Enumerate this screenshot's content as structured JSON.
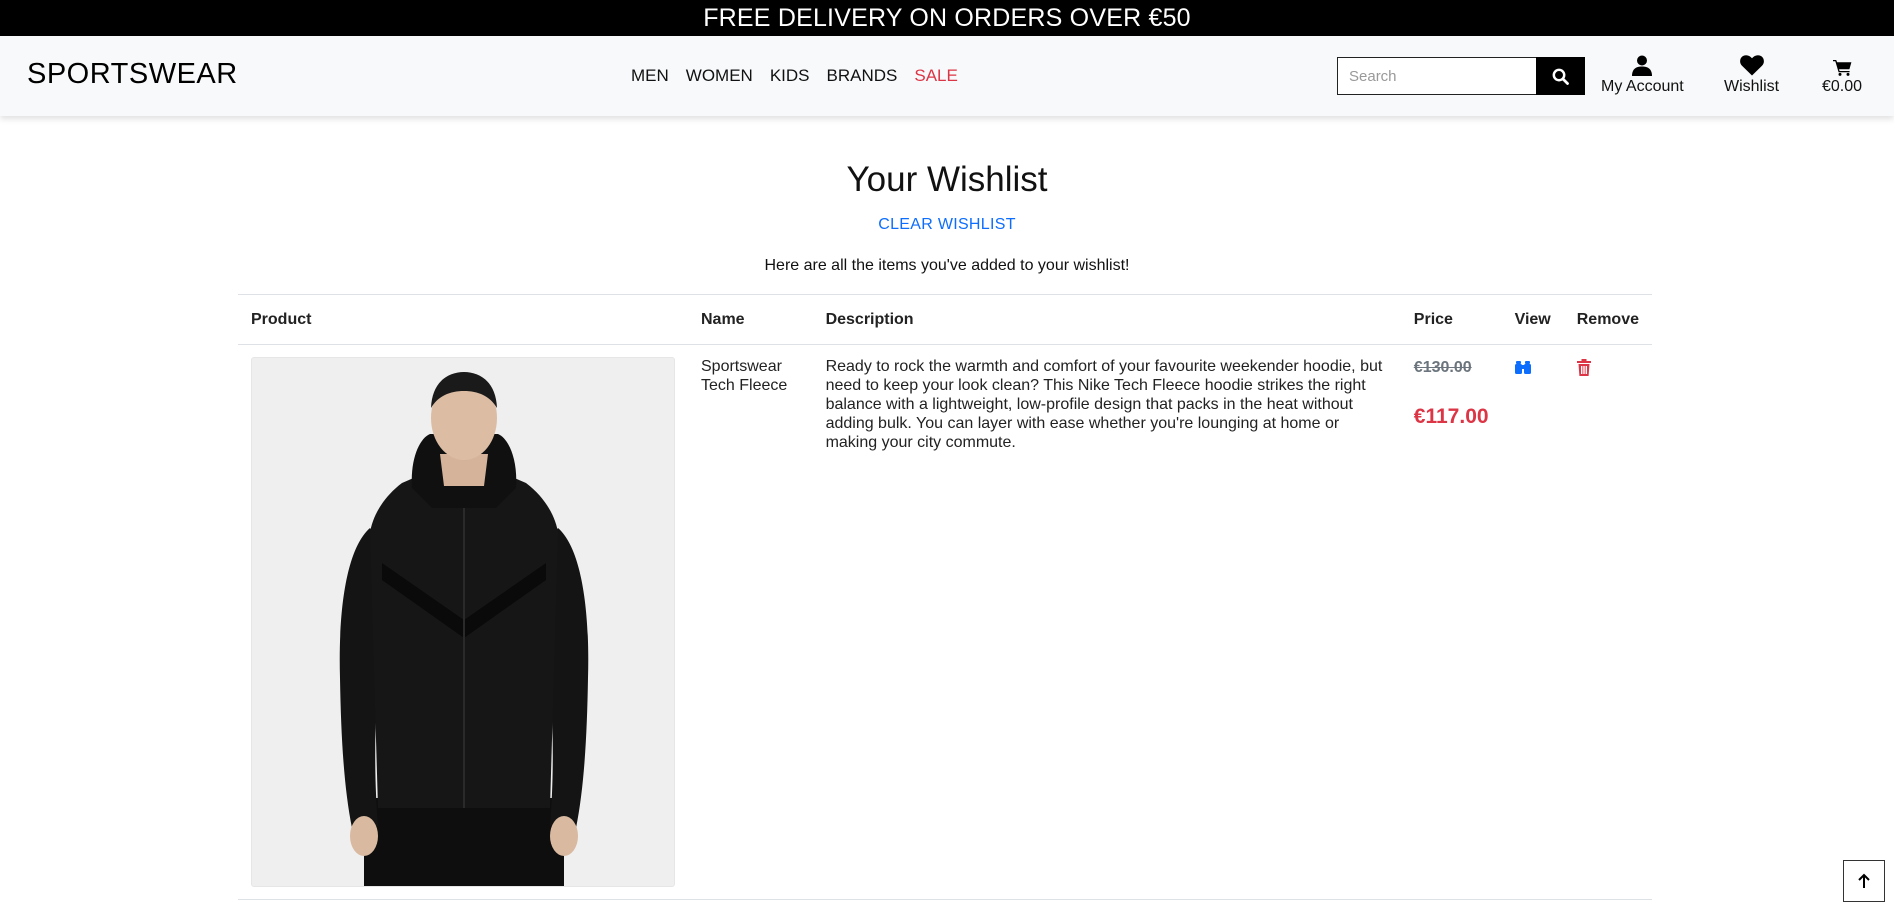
{
  "promo": {
    "text": "FREE DELIVERY ON ORDERS OVER €50"
  },
  "header": {
    "logo": "SPORTSWEAR",
    "nav": [
      {
        "label": "MEN"
      },
      {
        "label": "WOMEN"
      },
      {
        "label": "KIDS"
      },
      {
        "label": "BRANDS"
      },
      {
        "label": "SALE",
        "color": "#dc3545"
      }
    ],
    "search": {
      "placeholder": "Search",
      "icon": "search-icon"
    },
    "account": {
      "label": "My Account",
      "icon": "user-icon"
    },
    "wishlist": {
      "label": "Wishlist",
      "icon": "heart-icon"
    },
    "bag": {
      "label": "€0.00",
      "icon": "cart-icon"
    }
  },
  "main": {
    "title": "Your Wishlist",
    "clear_label": "CLEAR WISHLIST",
    "intro": "Here are all the items you've added to your wishlist!",
    "table": {
      "headers": [
        "Product",
        "Name",
        "Description",
        "Price",
        "View",
        "Remove"
      ],
      "rows": [
        {
          "name": "Sportswear Tech Fleece",
          "description": "Ready to rock the warmth and comfort of your favourite weekender hoodie, but need to keep your look clean? This Nike Tech Fleece hoodie strikes the right balance with a lightweight, low-profile design that packs in the heat without adding bulk. You can layer with ease whether you're lounging at home or making your city commute.",
          "original_price": "€130.00",
          "sale_price": "€117.00",
          "view_icon": "binoculars-icon",
          "remove_icon": "trash-icon"
        }
      ]
    }
  },
  "colors": {
    "accent": "#0d6efd",
    "sale": "#dc3545",
    "promo_bg": "#000000"
  },
  "back_to_top": {
    "icon": "arrow-up-icon"
  }
}
